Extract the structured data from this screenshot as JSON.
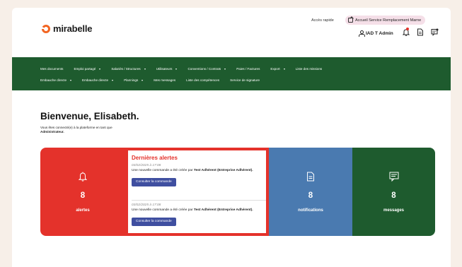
{
  "brand": {
    "name": "mirabelle",
    "accent": "#f26522"
  },
  "header": {
    "quick_access": "Accès rapide",
    "service_button": "Accueil Service Remplacement Marne",
    "user_name": "IAD T Admin"
  },
  "nav": {
    "row1": [
      {
        "label": "Mes documents",
        "dropdown": false
      },
      {
        "label": "Emploi partagé",
        "dropdown": true
      },
      {
        "label": "Salariés / Structures",
        "dropdown": true
      },
      {
        "label": "Utilisateurs",
        "dropdown": true
      },
      {
        "label": "Conventions / Contrats",
        "dropdown": true
      },
      {
        "label": "Paies / Factures",
        "dropdown": false
      },
      {
        "label": "Export",
        "dropdown": true
      },
      {
        "label": "Liste des missions",
        "dropdown": false
      }
    ],
    "row2": [
      {
        "label": "Embauche directe",
        "dropdown": true
      },
      {
        "label": "Embauche directe",
        "dropdown": true
      },
      {
        "label": "Plannings",
        "dropdown": true
      },
      {
        "label": "Mes messages",
        "dropdown": false
      },
      {
        "label": "Liste des compétences",
        "dropdown": false
      },
      {
        "label": "Service de signature",
        "dropdown": false
      }
    ]
  },
  "main": {
    "welcome": "Bienvenue, Elisabeth.",
    "connected_prefix": "Vous êtes connecté(e) à la plateforme en tant que",
    "connected_role": "Administrateur."
  },
  "stats": {
    "alerts": {
      "count": "8",
      "label": "alertes",
      "icon": "bell-icon",
      "color": "#e4322b"
    },
    "notifications": {
      "count": "8",
      "label": "notifications",
      "icon": "document-icon",
      "color": "#4a7ab0"
    },
    "messages": {
      "count": "8",
      "label": "messages",
      "icon": "message-icon",
      "color": "#1e5b2e"
    }
  },
  "alerts_panel": {
    "title": "Dernières alertes",
    "items": [
      {
        "date": "03/02/2025 à 17:08",
        "message_prefix": "Une nouvelle commande a été créée par",
        "message_bold": "Test Adhérent (Entreprise Adhérent).",
        "button": "Consulter la commande"
      },
      {
        "date": "03/02/2025 à 17:08",
        "message_prefix": "Une nouvelle commande a été créée par",
        "message_bold": "Test Adhérent (Entreprise Adhérent).",
        "button": "Consulter la commande"
      }
    ]
  }
}
